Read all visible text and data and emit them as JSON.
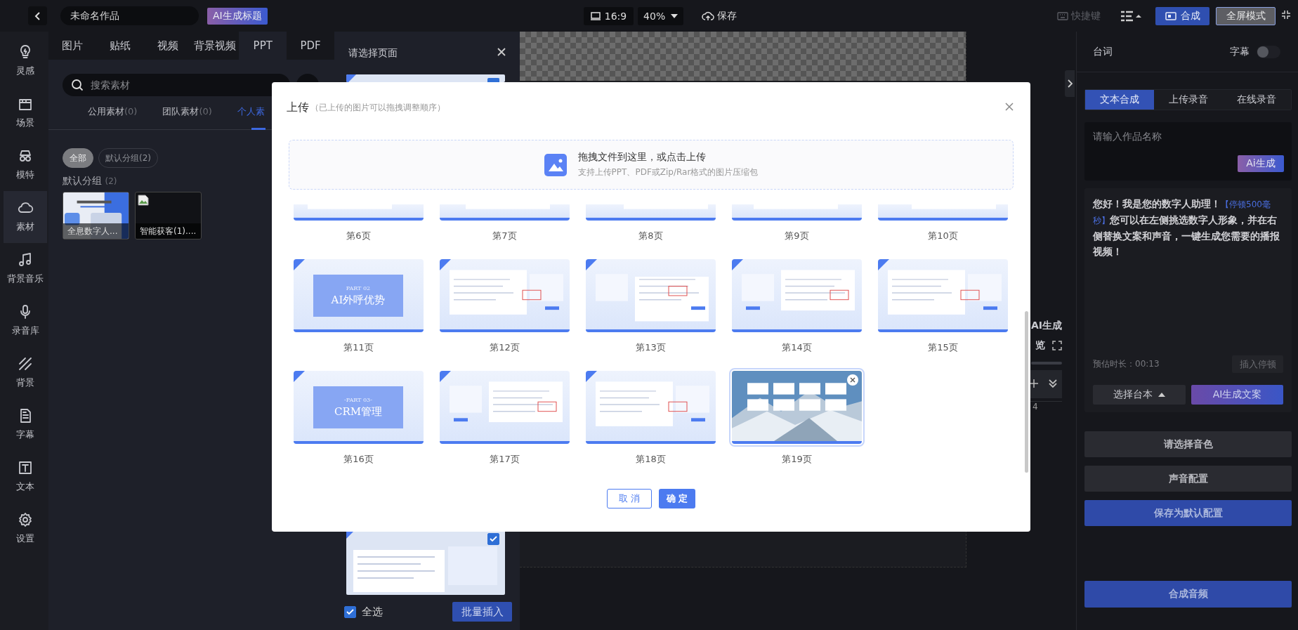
{
  "topbar": {
    "title": "未命名作品",
    "ai_title": "AI生成标题",
    "ratio": "16:9",
    "zoom": "40%",
    "save": "保存",
    "shortcuts": "快捷键",
    "compose": "合成",
    "fullscreen": "全屏模式"
  },
  "rail": [
    {
      "label": "灵感",
      "selected": false
    },
    {
      "label": "场景",
      "selected": false
    },
    {
      "label": "模特",
      "selected": false
    },
    {
      "label": "素材",
      "selected": true
    },
    {
      "label": "背景音乐",
      "selected": false
    },
    {
      "label": "录音库",
      "selected": false
    },
    {
      "label": "背景",
      "selected": false
    },
    {
      "label": "字幕",
      "selected": false
    },
    {
      "label": "文本",
      "selected": false
    },
    {
      "label": "设置",
      "selected": false
    }
  ],
  "assets": {
    "tabs": [
      {
        "label": "图片",
        "selected": false
      },
      {
        "label": "贴纸",
        "selected": false
      },
      {
        "label": "视频",
        "selected": false
      },
      {
        "label": "背景视频",
        "selected": false
      },
      {
        "label": "PPT",
        "selected": true
      },
      {
        "label": "PDF",
        "selected": false
      }
    ],
    "search": {
      "placeholder": "搜索素材"
    },
    "scopes": [
      {
        "label": "公用素材",
        "count": "(0)",
        "selected": false
      },
      {
        "label": "团队素材",
        "count": "(0)",
        "selected": false
      },
      {
        "label": "个人素",
        "selected": true
      }
    ],
    "chips": [
      {
        "label": "全部",
        "selected": true
      },
      {
        "label": "默认分组(2)",
        "selected": false
      }
    ],
    "group": {
      "name": "默认分组",
      "count": "(2)"
    },
    "items": [
      {
        "name": "全息数字人...",
        "kind": "slide"
      },
      {
        "name": "智能获客(1)....",
        "kind": "broken"
      }
    ]
  },
  "page_picker": {
    "title": "请选择页面",
    "pages": [
      {
        "checked": true
      },
      {
        "checked": true
      }
    ],
    "select_all": {
      "label": "全选",
      "checked": true
    },
    "insert": "批量插入"
  },
  "timeline": {
    "ai": "AI生成",
    "preview": "览",
    "ruler": "4"
  },
  "modal": {
    "title": "上传",
    "hint": "（已上传的图片可以拖拽调整顺序）",
    "drop": {
      "title": "拖拽文件到这里，或点击上传",
      "hint": "支持上传PPT、PDF或Zip/Rar格式的图片压缩包"
    },
    "pages": [
      {
        "label": "第6页",
        "kind": "partial",
        "selected": false
      },
      {
        "label": "第7页",
        "kind": "partial",
        "selected": false
      },
      {
        "label": "第8页",
        "kind": "partial",
        "selected": false
      },
      {
        "label": "第9页",
        "kind": "partial",
        "selected": false
      },
      {
        "label": "第10页",
        "kind": "partial",
        "selected": false
      },
      {
        "label": "第11页",
        "kind": "cover",
        "part": "PART 02",
        "title": "AI外呼优势",
        "selected": false
      },
      {
        "label": "第12页",
        "kind": "screenshot",
        "selected": false
      },
      {
        "label": "第13页",
        "kind": "screenshot",
        "selected": false
      },
      {
        "label": "第14页",
        "kind": "screenshot",
        "selected": false
      },
      {
        "label": "第15页",
        "kind": "screenshot",
        "selected": false
      },
      {
        "label": "第16页",
        "kind": "cover",
        "part": "-PART 03-",
        "title": "CRM管理",
        "selected": false
      },
      {
        "label": "第17页",
        "kind": "screenshot",
        "selected": false
      },
      {
        "label": "第18页",
        "kind": "screenshot",
        "selected": false
      },
      {
        "label": "第19页",
        "selected": true
      }
    ],
    "cancel": "取 消",
    "ok": "确 定"
  },
  "right": {
    "title": "台词",
    "subtitles": {
      "label": "字幕",
      "on": false
    },
    "tabs": [
      {
        "label": "文本合成",
        "selected": true
      },
      {
        "label": "上传录音",
        "selected": false
      },
      {
        "label": "在线录音",
        "selected": false
      }
    ],
    "name_field": {
      "placeholder": "请输入作品名称"
    },
    "ai_button": "Ai生成",
    "script": [
      {
        "text": "您好！我是您的数字人助理！",
        "kind": "text"
      },
      {
        "text": "【停顿500毫秒】",
        "kind": "pause"
      },
      {
        "text": "您可以在左侧挑选数字人形象，并在右侧替换文案和声音，一键生成您需要的播报视频！",
        "kind": "text"
      }
    ],
    "duration": "预估时长：00:13",
    "insert_pause": "插入停顿",
    "choose_script": "选择台本",
    "ai_copy": "AI生成文案",
    "buttons": [
      {
        "label": "请选择音色",
        "kind": "secondary"
      },
      {
        "label": "声音配置",
        "kind": "secondary"
      },
      {
        "label": "保存为默认配置",
        "kind": "primary"
      }
    ],
    "synth": "合成音频"
  }
}
